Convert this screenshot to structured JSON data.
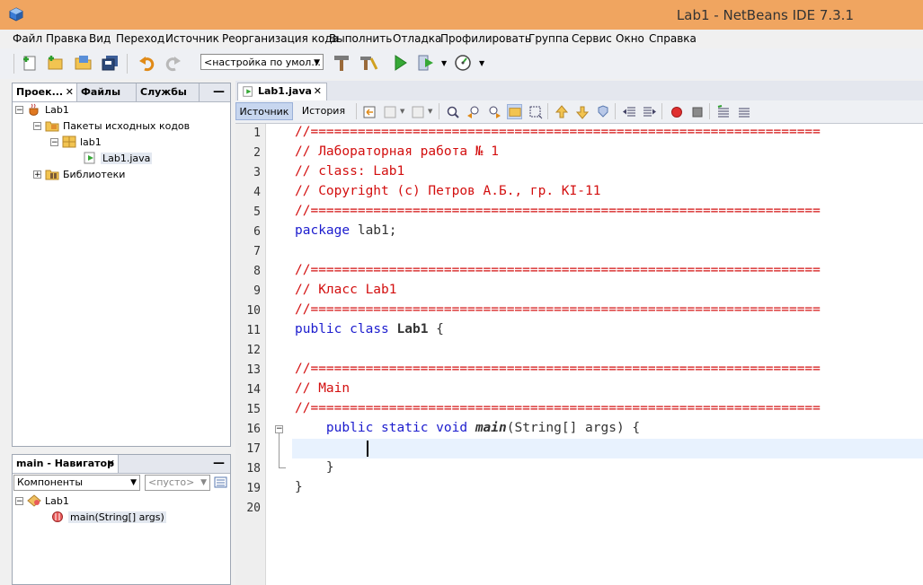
{
  "window": {
    "title": "Lab1 - NetBeans IDE 7.3.1"
  },
  "menu": [
    "Файл",
    "Правка",
    "Вид",
    "Переход",
    "Источник",
    "Реорганизация кода",
    "Выполнить",
    "Отладка",
    "Профилировать",
    "Группа",
    "Сервис",
    "Окно",
    "Справка"
  ],
  "toolbar": {
    "config_select": "<настройка по умол..."
  },
  "projects_panel": {
    "tabs": [
      "Проек...",
      "Файлы",
      "Службы"
    ],
    "tree": {
      "project": "Lab1",
      "source_packages": "Пакеты исходных кодов",
      "package": "lab1",
      "file": "Lab1.java",
      "libraries": "Библиотеки"
    }
  },
  "navigator": {
    "title": "main - Навигатор",
    "filter_select": "Компоненты",
    "member_select": "<пусто>",
    "tree": {
      "class": "Lab1",
      "method": "main(String[] args)"
    }
  },
  "editor": {
    "tab": "Lab1.java",
    "views": [
      "Источник",
      "История"
    ],
    "lines": [
      "//=================================================================",
      "// Лабораторная работа № 1",
      "// class: Lab1",
      "// Copyright (c) Петров А.Б., гр. КІ-11",
      "//=================================================================",
      "package lab1;",
      "",
      "//=================================================================",
      "// Класс Lab1",
      "//=================================================================",
      "public class Lab1 {",
      "",
      "//=================================================================",
      "// Main",
      "//=================================================================",
      "    public static void main(String[] args) {",
      "",
      "    }",
      "}",
      ""
    ],
    "line_numbers": [
      "1",
      "2",
      "3",
      "4",
      "5",
      "6",
      "7",
      "8",
      "9",
      "10",
      "11",
      "12",
      "13",
      "14",
      "15",
      "16",
      "17",
      "18",
      "19",
      "20"
    ],
    "code_tokens": {
      "kw_package": "package",
      "pkg_name": " lab1;",
      "kw_public": "public",
      "kw_class": "class",
      "class_name": "Lab1",
      "brace_open": "{",
      "kw_static": "static",
      "kw_void": "void",
      "method_name": "main",
      "params": "(String[] args) {",
      "brace_close": "}"
    },
    "colors": {
      "comment": "#d30f0f",
      "keyword": "#1c1cce",
      "current_line": "#e8f2fe"
    }
  }
}
